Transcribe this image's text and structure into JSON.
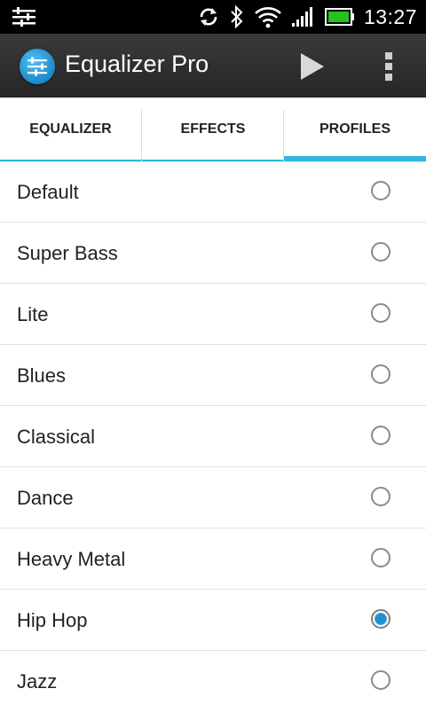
{
  "status_bar": {
    "time": "13:27",
    "icons": [
      "equalizer-notification-icon",
      "sync-icon",
      "bluetooth-icon",
      "wifi-icon",
      "signal-icon",
      "battery-icon"
    ]
  },
  "action_bar": {
    "title": "Equalizer Pro",
    "icons": [
      "equalizer-app-icon",
      "play-icon",
      "overflow-menu-icon"
    ]
  },
  "tabs": [
    {
      "label": "EQUALIZER",
      "selected": false
    },
    {
      "label": "EFFECTS",
      "selected": false
    },
    {
      "label": "PROFILES",
      "selected": true
    }
  ],
  "profiles": [
    {
      "label": "Default",
      "selected": false
    },
    {
      "label": "Super Bass",
      "selected": false
    },
    {
      "label": "Lite",
      "selected": false
    },
    {
      "label": "Blues",
      "selected": false
    },
    {
      "label": "Classical",
      "selected": false
    },
    {
      "label": "Dance",
      "selected": false
    },
    {
      "label": "Heavy Metal",
      "selected": false
    },
    {
      "label": "Hip Hop",
      "selected": true
    },
    {
      "label": "Jazz",
      "selected": false
    }
  ],
  "colors": {
    "accent": "#33b5e5",
    "radio_selected": "#1e90d0",
    "action_bar": "#2e2e2e",
    "status_bar": "#000000"
  }
}
